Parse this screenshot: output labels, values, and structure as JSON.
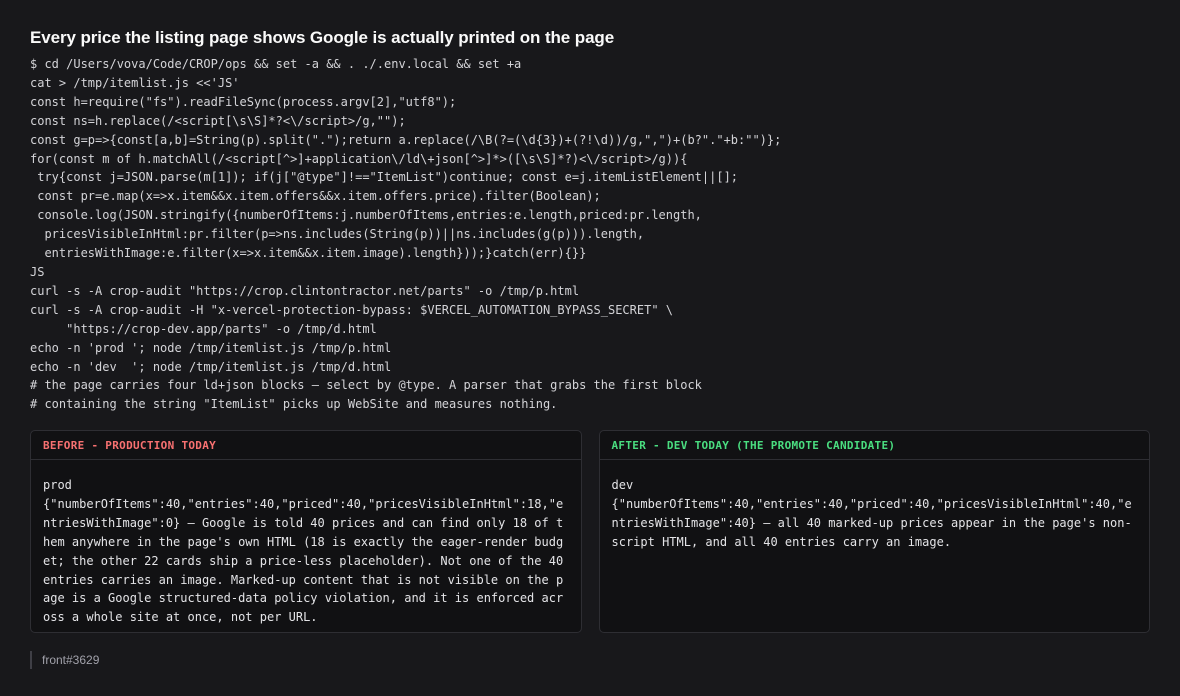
{
  "title": "Every price the listing page shows Google is actually printed on the page",
  "code_lines": [
    "$ cd /Users/vova/Code/CROP/ops && set -a && . ./.env.local && set +a",
    "cat > /tmp/itemlist.js <<'JS'",
    "const h=require(\"fs\").readFileSync(process.argv[2],\"utf8\");",
    "const ns=h.replace(/<script[\\s\\S]*?<\\/script>/g,\"\");",
    "const g=p=>{const[a,b]=String(p).split(\".\");return a.replace(/\\B(?=(\\d{3})+(?!\\d))/g,\",\")+(b?\".\"+b:\"\")};",
    "for(const m of h.matchAll(/<script[^>]+application\\/ld\\+json[^>]*>([\\s\\S]*?)<\\/script>/g)){",
    " try{const j=JSON.parse(m[1]); if(j[\"@type\"]!==\"ItemList\")continue; const e=j.itemListElement||[];",
    " const pr=e.map(x=>x.item&&x.item.offers&&x.item.offers.price).filter(Boolean);",
    " console.log(JSON.stringify({numberOfItems:j.numberOfItems,entries:e.length,priced:pr.length,",
    "  pricesVisibleInHtml:pr.filter(p=>ns.includes(String(p))||ns.includes(g(p))).length,",
    "  entriesWithImage:e.filter(x=>x.item&&x.item.image).length}));}catch(err){}}",
    "JS",
    "curl -s -A crop-audit \"https://crop.clintontractor.net/parts\" -o /tmp/p.html",
    "curl -s -A crop-audit -H \"x-vercel-protection-bypass: $VERCEL_AUTOMATION_BYPASS_SECRET\" \\",
    "     \"https://crop-dev.app/parts\" -o /tmp/d.html",
    "echo -n 'prod '; node /tmp/itemlist.js /tmp/p.html",
    "echo -n 'dev  '; node /tmp/itemlist.js /tmp/d.html",
    "# the page carries four ld+json blocks — select by @type. A parser that grabs the first block",
    "# containing the string \"ItemList\" picks up WebSite and measures nothing."
  ],
  "panels": {
    "before": {
      "heading": "BEFORE - PRODUCTION TODAY",
      "label": "prod",
      "body": "{\"numberOfItems\":40,\"entries\":40,\"priced\":40,\"pricesVisibleInHtml\":18,\"entriesWithImage\":0} — Google is told 40 prices and can find only 18 of them anywhere in the page's own HTML (18 is exactly the eager-render budget; the other 22 cards ship a price-less placeholder). Not one of the 40 entries carries an image. Marked-up content that is not visible on the page is a Google structured-data policy violation, and it is enforced across a whole site at once, not per URL."
    },
    "after": {
      "heading": "AFTER - DEV TODAY (THE PROMOTE CANDIDATE)",
      "label": "dev",
      "body": "{\"numberOfItems\":40,\"entries\":40,\"priced\":40,\"pricesVisibleInHtml\":40,\"entriesWithImage\":40} — all 40 marked-up prices appear in the page's non-script HTML, and all 40 entries carry an image."
    }
  },
  "footer": {
    "ref": "front#3629"
  },
  "colors": {
    "background": "#18181b",
    "before_accent": "#f87171",
    "after_accent": "#4ade80"
  }
}
